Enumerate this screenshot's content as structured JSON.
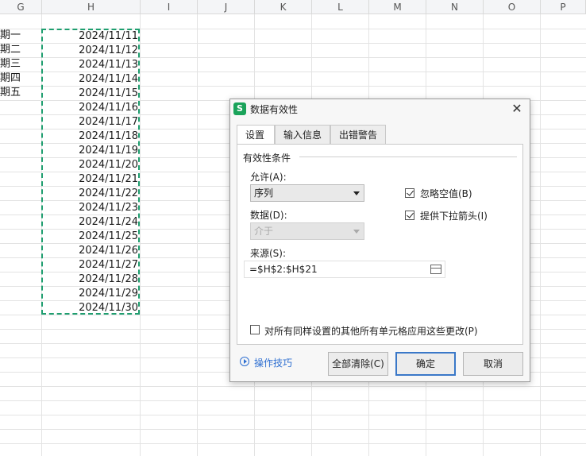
{
  "columns": [
    "G",
    "H",
    "I",
    "J",
    "K",
    "L",
    "M",
    "N",
    "O",
    "P"
  ],
  "weekday_cells": [
    "期一",
    "期二",
    "期三",
    "期四",
    "期五"
  ],
  "date_cells": [
    "2024/11/11",
    "2024/11/12",
    "2024/11/13",
    "2024/11/14",
    "2024/11/15",
    "2024/11/16",
    "2024/11/17",
    "2024/11/18",
    "2024/11/19",
    "2024/11/20",
    "2024/11/21",
    "2024/11/22",
    "2024/11/23",
    "2024/11/24",
    "2024/11/25",
    "2024/11/26",
    "2024/11/27",
    "2024/11/28",
    "2024/11/29",
    "2024/11/30"
  ],
  "dialog": {
    "app_icon_letter": "S",
    "title": "数据有效性",
    "tabs": [
      {
        "label": "设置",
        "active": true
      },
      {
        "label": "输入信息",
        "active": false
      },
      {
        "label": "出错警告",
        "active": false
      }
    ],
    "group_title": "有效性条件",
    "allow": {
      "label": "允许(A):",
      "value": "序列"
    },
    "data": {
      "label": "数据(D):",
      "value": "介于",
      "disabled": true
    },
    "ignore_blank": {
      "label": "忽略空值(B)",
      "checked": true
    },
    "dropdown_arrow": {
      "label": "提供下拉箭头(I)",
      "checked": true
    },
    "source": {
      "label": "来源(S):",
      "value": "=$H$2:$H$21"
    },
    "apply_all": {
      "label": "对所有同样设置的其他所有单元格应用这些更改(P)",
      "checked": false
    },
    "tips_label": "操作技巧",
    "clear_all_label": "全部清除(C)",
    "ok_label": "确定",
    "cancel_label": "取消"
  },
  "colors": {
    "accent": "#1f9e6f",
    "link": "#2e6fd1",
    "primary_border": "#3a78c8"
  }
}
